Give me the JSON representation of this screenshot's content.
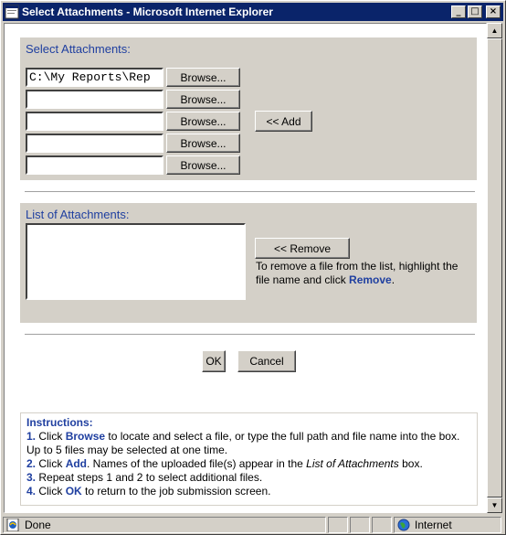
{
  "window": {
    "title": "Select Attachments - Microsoft Internet Explorer",
    "controls": {
      "minimize": "_",
      "maximize": "□",
      "close": "×"
    }
  },
  "select_section": {
    "heading": "Select Attachments:",
    "file_values": [
      "C:\\My Reports\\Rep",
      "",
      "",
      "",
      ""
    ],
    "browse_label": "Browse...",
    "add_label": "<< Add"
  },
  "list_section": {
    "heading": "List of Attachments:",
    "remove_label": "<< Remove",
    "help_pre": "To remove a file from the list, highlight the file name and click ",
    "help_keyword": "Remove",
    "help_post": "."
  },
  "dialog_buttons": {
    "ok": "OK",
    "cancel": "Cancel"
  },
  "instructions": {
    "heading": "Instructions:",
    "step1": {
      "num": "1.",
      "pre": " Click ",
      "kw": "Browse",
      "post": " to locate and select a file, or type the full path and file name into the box. Up to 5 files may be selected at one time."
    },
    "step2": {
      "num": "2.",
      "pre": " Click ",
      "kw": "Add",
      "mid": ". Names of the uploaded file(s) appear in the ",
      "em": "List of Attachments",
      "post": " box."
    },
    "step3": {
      "num": "3.",
      "text": " Repeat steps 1 and 2 to select additional files."
    },
    "step4": {
      "num": "4.",
      "pre": " Click ",
      "kw": "OK",
      "post": " to return to the job submission screen."
    }
  },
  "status_bar": {
    "status": "Done",
    "zone": "Internet"
  },
  "icons": [
    "ie-icon",
    "done-page-icon",
    "internet-globe-icon",
    "scroll-up-icon",
    "scroll-down-icon"
  ]
}
